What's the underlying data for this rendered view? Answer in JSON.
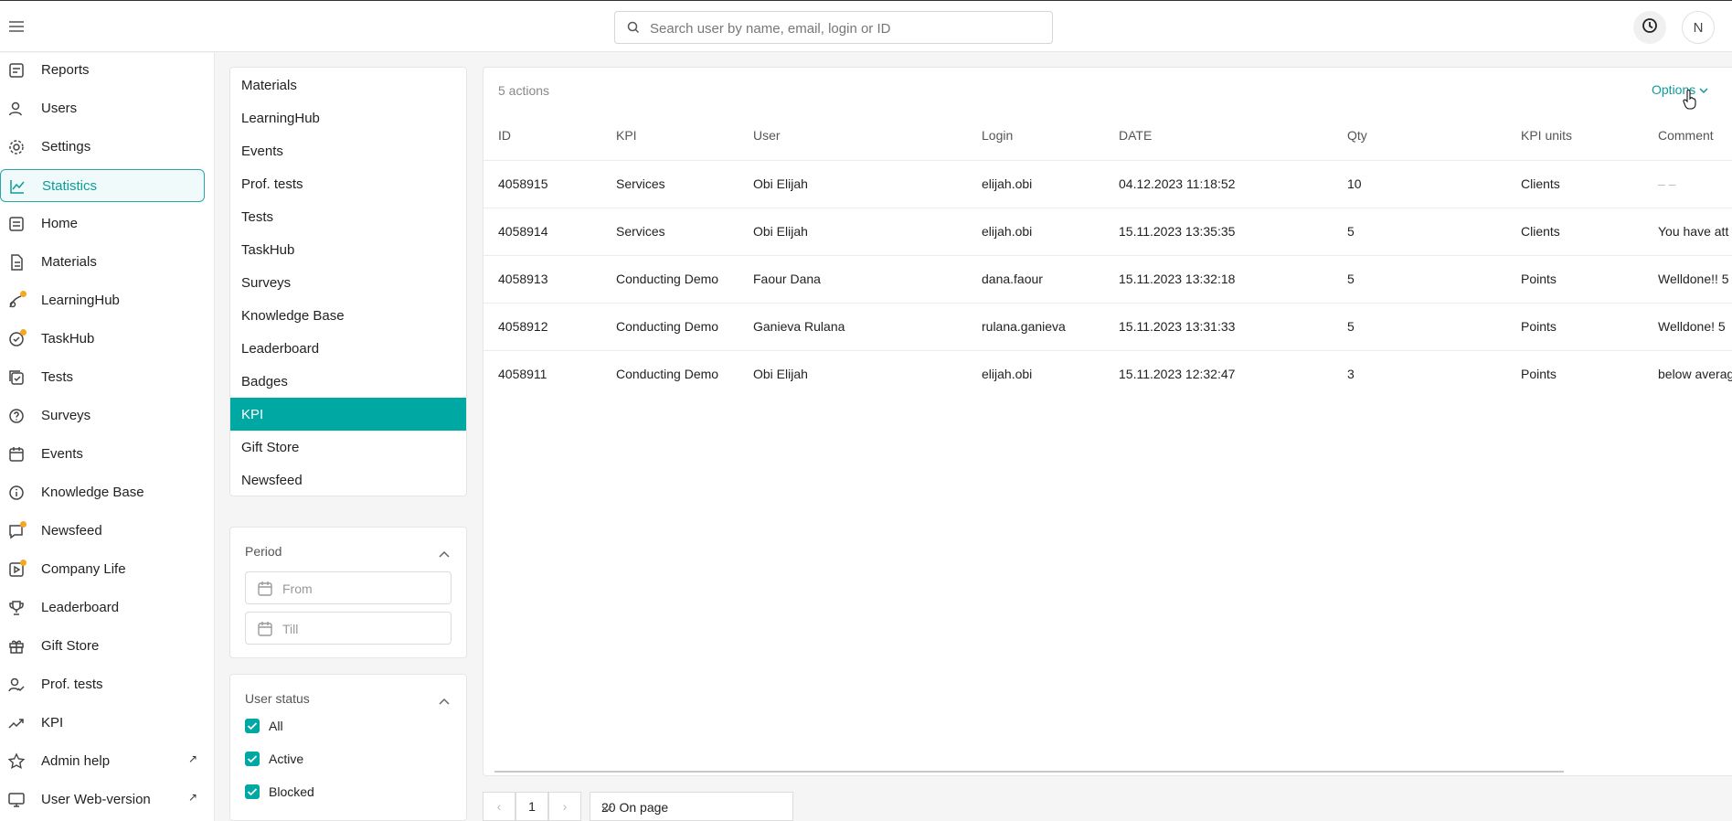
{
  "search": {
    "placeholder": "Search user by name, email, login or ID"
  },
  "header": {
    "avatar_initial": "N"
  },
  "sidebar": {
    "items": [
      {
        "label": "Reports",
        "icon": "reports-icon"
      },
      {
        "label": "Users",
        "icon": "users-icon"
      },
      {
        "label": "Settings",
        "icon": "gear-icon"
      },
      {
        "label": "Statistics",
        "icon": "chart-line-icon",
        "active": true
      },
      {
        "label": "Home",
        "icon": "home-icon"
      },
      {
        "label": "Materials",
        "icon": "document-icon"
      },
      {
        "label": "LearningHub",
        "icon": "learninghub-icon",
        "badge": true
      },
      {
        "label": "TaskHub",
        "icon": "taskhub-icon",
        "badge": true
      },
      {
        "label": "Tests",
        "icon": "tests-icon"
      },
      {
        "label": "Surveys",
        "icon": "survey-icon"
      },
      {
        "label": "Events",
        "icon": "calendar-icon"
      },
      {
        "label": "Knowledge Base",
        "icon": "info-icon"
      },
      {
        "label": "Newsfeed",
        "icon": "chat-icon",
        "badge": true
      },
      {
        "label": "Company Life",
        "icon": "video-icon",
        "badge": true
      },
      {
        "label": "Leaderboard",
        "icon": "trophy-icon"
      },
      {
        "label": "Gift Store",
        "icon": "gift-icon"
      },
      {
        "label": "Prof. tests",
        "icon": "user-check-icon"
      },
      {
        "label": "KPI",
        "icon": "trend-icon"
      },
      {
        "label": "Admin help",
        "icon": "star-icon",
        "external": true
      },
      {
        "label": "User Web-version",
        "icon": "monitor-icon",
        "external": true
      }
    ]
  },
  "categories": {
    "items": [
      "Materials",
      "LearningHub",
      "Events",
      "Prof. tests",
      "Tests",
      "TaskHub",
      "Surveys",
      "Knowledge Base",
      "Leaderboard",
      "Badges",
      "KPI",
      "Gift Store",
      "Newsfeed"
    ],
    "active": "KPI"
  },
  "filters": {
    "period": {
      "title": "Period",
      "from_placeholder": "From",
      "till_placeholder": "Till"
    },
    "user_status": {
      "title": "User status",
      "options": [
        "All",
        "Active",
        "Blocked"
      ]
    }
  },
  "table": {
    "count_label": "5 actions",
    "options_label": "Options",
    "columns": [
      "ID",
      "KPI",
      "User",
      "Login",
      "DATE",
      "Qty",
      "KPI units",
      "Comment"
    ],
    "rows": [
      [
        "4058915",
        "Services",
        "Obi Elijah",
        "elijah.obi",
        "04.12.2023 11:18:52",
        "10",
        "Clients",
        "– –"
      ],
      [
        "4058914",
        "Services",
        "Obi Elijah",
        "elijah.obi",
        "15.11.2023 13:35:35",
        "5",
        "Clients",
        "You have att"
      ],
      [
        "4058913",
        "Conducting Demo",
        "Faour Dana",
        "dana.faour",
        "15.11.2023 13:32:18",
        "5",
        "Points",
        "Welldone!! 5"
      ],
      [
        "4058912",
        "Conducting Demo",
        "Ganieva Rulana",
        "rulana.ganieva",
        "15.11.2023 13:31:33",
        "5",
        "Points",
        "Welldone! 5"
      ],
      [
        "4058911",
        "Conducting Demo",
        "Obi Elijah",
        "elijah.obi",
        "15.11.2023 12:32:47",
        "3",
        "Points",
        "below averag"
      ]
    ]
  },
  "pagination": {
    "prev": "‹",
    "page": "1",
    "next": "›",
    "page_size": "20 On page"
  },
  "colors": {
    "accent": "#00a8a3",
    "accent_text": "#0d9c99",
    "badge": "#f5a623"
  }
}
